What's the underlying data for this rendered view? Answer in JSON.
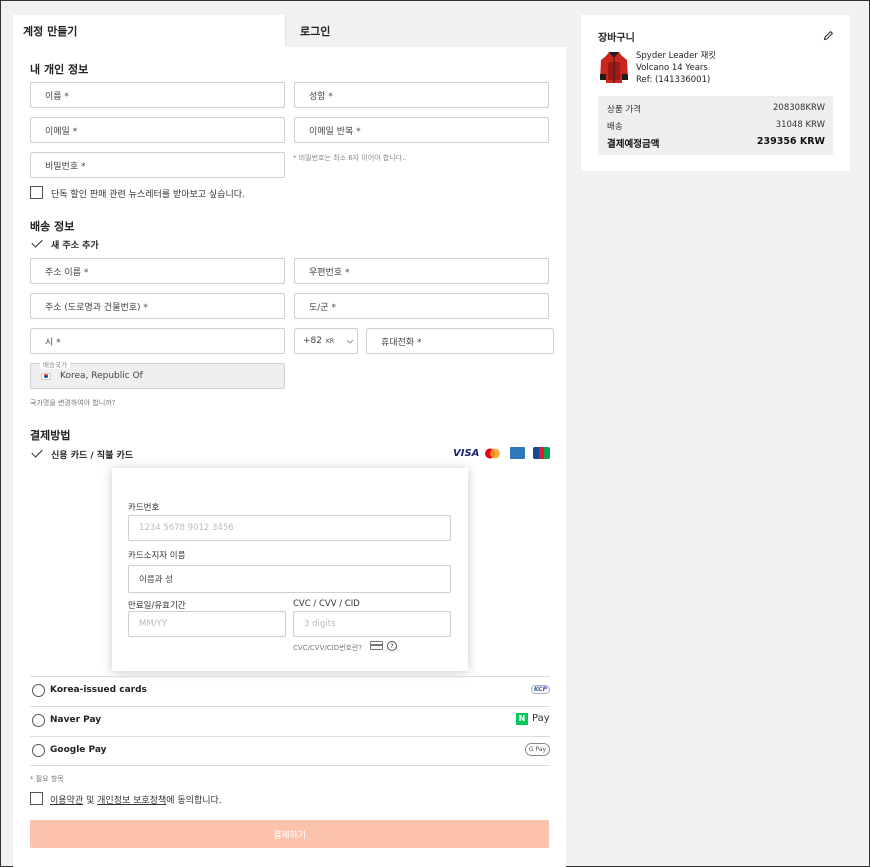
{
  "tabs": {
    "signup": "계정 만들기",
    "login": "로그인"
  },
  "personal": {
    "title": "내 개인 정보",
    "first_name": "이름 *",
    "last_name": "성함 *",
    "email": "이메일 *",
    "email_repeat": "이메일 반복 *",
    "password": "비밀번호 *",
    "password_hint": "* 비밀번호는 최소 6자 이어야 합니다..",
    "newsletter": "단독 할인 판매 관련 뉴스레터를 받아보고 싶습니다."
  },
  "shipping": {
    "title": "배송 정보",
    "new_address": "새 주소 추가",
    "address_name": "주소 이름 *",
    "postal_code": "우편번호 *",
    "address": "주소 (도로명과 건물번호) *",
    "province": "도/군 *",
    "city": "시 *",
    "phone_code": "+82",
    "phone_country": "KR",
    "mobile": "휴대전화 *",
    "country_label": "배송국가",
    "country_value": "Korea, Republic Of",
    "change_country": "국가명을 변경하여야 합니까?"
  },
  "payment": {
    "title": "결제방법",
    "credit_card": "신용 카드 / 직불 카드",
    "brands": [
      "VISA"
    ],
    "card_number_label": "카드번호",
    "card_number_placeholder": "1234 5678 9012 3456",
    "holder_label": "카드소지자 이름",
    "holder_value": "이름과 성",
    "expiry_label": "만료일/유효기간",
    "expiry_placeholder": "MM/YY",
    "cvc_label": "CVC / CVV / CID",
    "cvc_placeholder": "3 digits",
    "cvc_help": "CVC/CVV/CID번호란?",
    "korea_cards": "Korea-issued cards",
    "korea_badge": "KCP",
    "naver_pay": "Naver Pay",
    "naver_logo_letter": "N",
    "naver_logo_text": "Pay",
    "google_pay": "Google Pay",
    "google_badge": "G Pay"
  },
  "required_note": "* 필요 항목",
  "terms": {
    "link1": "이용약관",
    "and": " 및 ",
    "link2": "개인정보 보호정책",
    "suffix": "에 동의합니다."
  },
  "submit_label": "결제하기",
  "cart": {
    "title": "장바구니",
    "product_name": "Spyder Leader 재킷",
    "product_variant": "Volcano 14 Years",
    "product_ref": "Ref: (141336001)",
    "subtotal_label": "상품 가격",
    "subtotal_value": "208308KRW",
    "shipping_label": "배송",
    "shipping_value": "31048 KRW",
    "total_label": "결제예정금액",
    "total_value": "239356 KRW"
  },
  "colors": {
    "submit_bg": "#fcc3ac",
    "visa_blue": "#1a1f71",
    "naver_green": "#03c75a"
  }
}
